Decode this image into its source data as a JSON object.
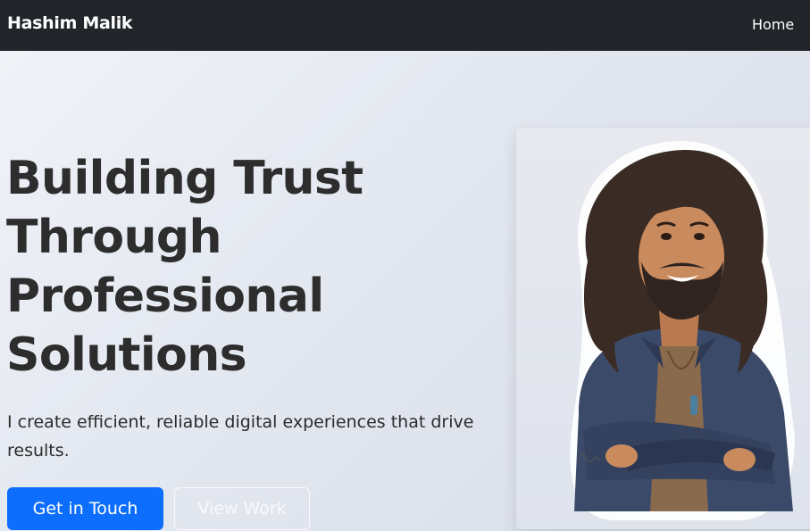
{
  "navbar": {
    "brand": "Hashim Malik",
    "links": [
      {
        "label": "Home"
      }
    ]
  },
  "hero": {
    "headline_lines": [
      "Building Trust",
      "Through",
      "Professional",
      "Solutions"
    ],
    "lead": "I create efficient, reliable digital experiences that drive results.",
    "primary_button": "Get in Touch",
    "secondary_button": "View Work"
  },
  "colors": {
    "navbar_bg": "#212529",
    "primary": "#0d6efd",
    "heading": "#2d2d2d"
  },
  "icons": [
    "portrait-illustration"
  ]
}
